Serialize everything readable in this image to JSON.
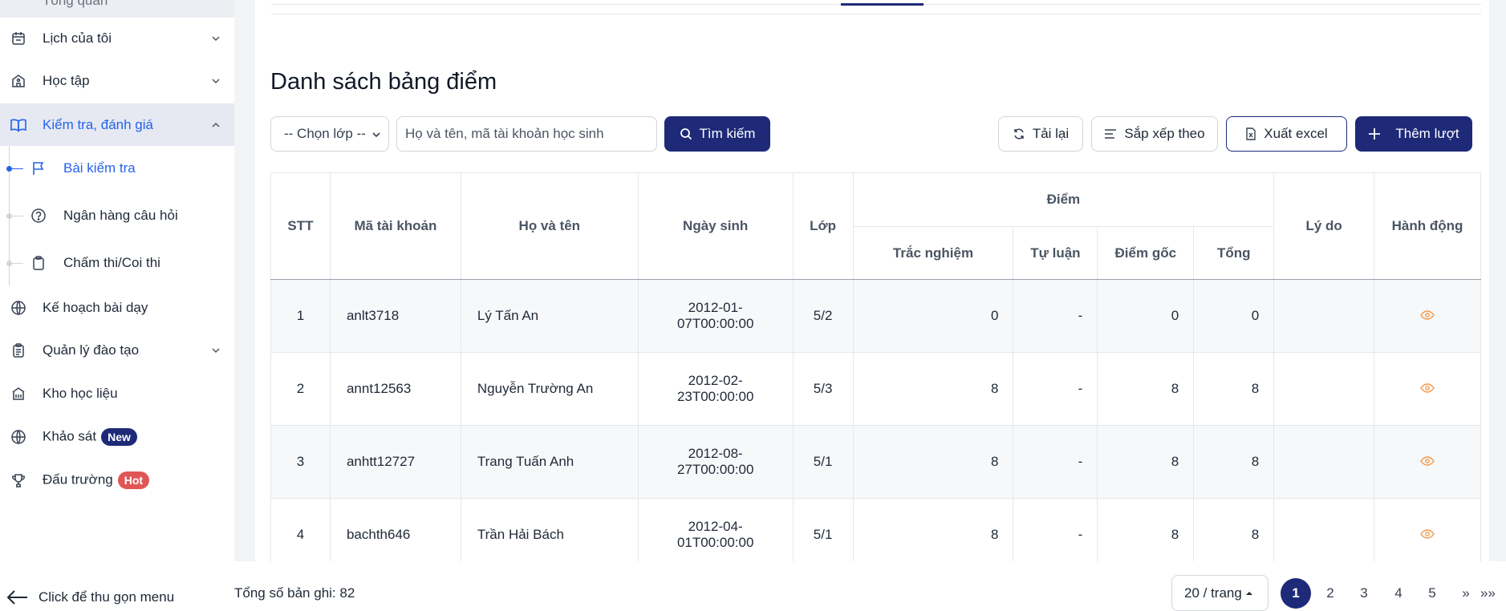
{
  "sidebar": {
    "top_partial": "Tổng quan",
    "items": [
      {
        "label": "Lịch của tôi",
        "icon": "calendar-icon"
      },
      {
        "label": "Học tập",
        "icon": "school-icon"
      },
      {
        "label": "Kiểm tra, đánh giá",
        "icon": "book-open-icon"
      },
      {
        "label": "Kế hoạch bài dạy",
        "icon": "globe-icon"
      },
      {
        "label": "Quản lý đào tạo",
        "icon": "clipboard-icon"
      },
      {
        "label": "Kho học liệu",
        "icon": "library-icon"
      },
      {
        "label": "Khảo sát",
        "icon": "globe-icon",
        "badge": "New"
      },
      {
        "label": "Đấu trường",
        "icon": "trophy-icon",
        "badge": "Hot"
      }
    ],
    "subitems": [
      {
        "label": "Bài kiểm tra",
        "icon": "flag-icon"
      },
      {
        "label": "Ngân hàng câu hỏi",
        "icon": "question-circle-icon"
      },
      {
        "label": "Chấm thi/Coi thi",
        "icon": "clipboard-icon"
      }
    ],
    "collapse_label": "Click để thu gọn menu"
  },
  "main": {
    "title": "Danh sách bảng điểm",
    "filters": {
      "class_select": "-- Chọn lớp --",
      "search_placeholder": "Họ và tên, mã tài khoản học sinh",
      "search_button": "Tìm kiếm"
    },
    "actions": {
      "reload": "Tải lại",
      "sort": "Sắp xếp theo",
      "export": "Xuất excel",
      "add": "Thêm lượt"
    },
    "table": {
      "headers": {
        "stt": "STT",
        "account": "Mã tài khoản",
        "name": "Họ và tên",
        "dob": "Ngày sinh",
        "class": "Lớp",
        "score_group": "Điểm",
        "mc": "Trắc nghiệm",
        "essay": "Tự luận",
        "raw": "Điểm gốc",
        "total": "Tổng",
        "reason": "Lý do",
        "action": "Hành động"
      },
      "rows": [
        {
          "stt": "1",
          "account": "anlt3718",
          "name": "Lý Tấn An",
          "dob_line1": "2012-01-",
          "dob_line2": "07T00:00:00",
          "class": "5/2",
          "mc": "0",
          "essay": "-",
          "raw": "0",
          "total": "0",
          "reason": ""
        },
        {
          "stt": "2",
          "account": "annt12563",
          "name": "Nguyễn Trường An",
          "dob_line1": "2012-02-",
          "dob_line2": "23T00:00:00",
          "class": "5/3",
          "mc": "8",
          "essay": "-",
          "raw": "8",
          "total": "8",
          "reason": ""
        },
        {
          "stt": "3",
          "account": "anhtt12727",
          "name": "Trang Tuấn Anh",
          "dob_line1": "2012-08-",
          "dob_line2": "27T00:00:00",
          "class": "5/1",
          "mc": "8",
          "essay": "-",
          "raw": "8",
          "total": "8",
          "reason": ""
        },
        {
          "stt": "4",
          "account": "bachth646",
          "name": "Trần Hải Bách",
          "dob_line1": "2012-04-",
          "dob_line2": "01T00:00:00",
          "class": "5/1",
          "mc": "8",
          "essay": "-",
          "raw": "8",
          "total": "8",
          "reason": ""
        }
      ]
    }
  },
  "footer": {
    "total_label": "Tổng số bản ghi: 82",
    "page_size": "20 / trang",
    "pages": [
      "1",
      "2",
      "3",
      "4",
      "5"
    ],
    "current_page": "1",
    "next": "»",
    "last": "»»"
  },
  "colors": {
    "primary": "#1e2a78",
    "active_blue": "#2563eb",
    "eye_orange": "#f2994a",
    "badge_hot": "#e05656"
  }
}
